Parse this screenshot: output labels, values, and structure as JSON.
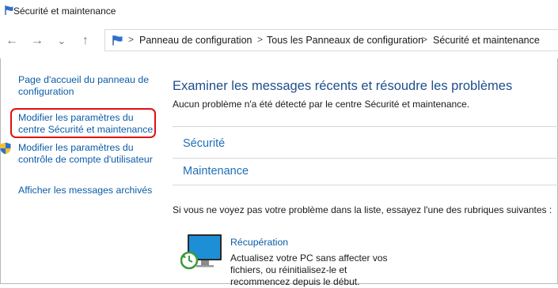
{
  "window": {
    "title": "Sécurité et maintenance"
  },
  "nav": {
    "back": "←",
    "forward": "→",
    "dropdown": "⌄",
    "up": "↑"
  },
  "address": {
    "crumbs": [
      "Panneau de configuration",
      "Tous les Panneaux de configuration",
      "Sécurité et maintenance"
    ],
    "separator": ">"
  },
  "sidebar": {
    "items": [
      {
        "label": "Page d'accueil du panneau de configuration"
      },
      {
        "label": "Modifier les paramètres du centre Sécurité et maintenance"
      },
      {
        "label": "Modifier les paramètres du contrôle de compte d'utilisateur"
      },
      {
        "label": "Afficher les messages archivés"
      }
    ]
  },
  "main": {
    "title": "Examiner les messages récents et résoudre les problèmes",
    "subtitle": "Aucun problème n'a été détecté par le centre Sécurité et maintenance.",
    "sections": [
      "Sécurité",
      "Maintenance"
    ],
    "hint": "Si vous ne voyez pas votre problème dans la liste, essayez l'une des rubriques suivantes :",
    "recovery": {
      "title": "Récupération",
      "description": "Actualisez votre PC sans affecter vos fichiers, ou réinitialisez-le et recommencez depuis le début."
    }
  },
  "colors": {
    "link": "#0a5ca8",
    "title": "#1e4e8c",
    "highlight_box": "#e01010"
  }
}
